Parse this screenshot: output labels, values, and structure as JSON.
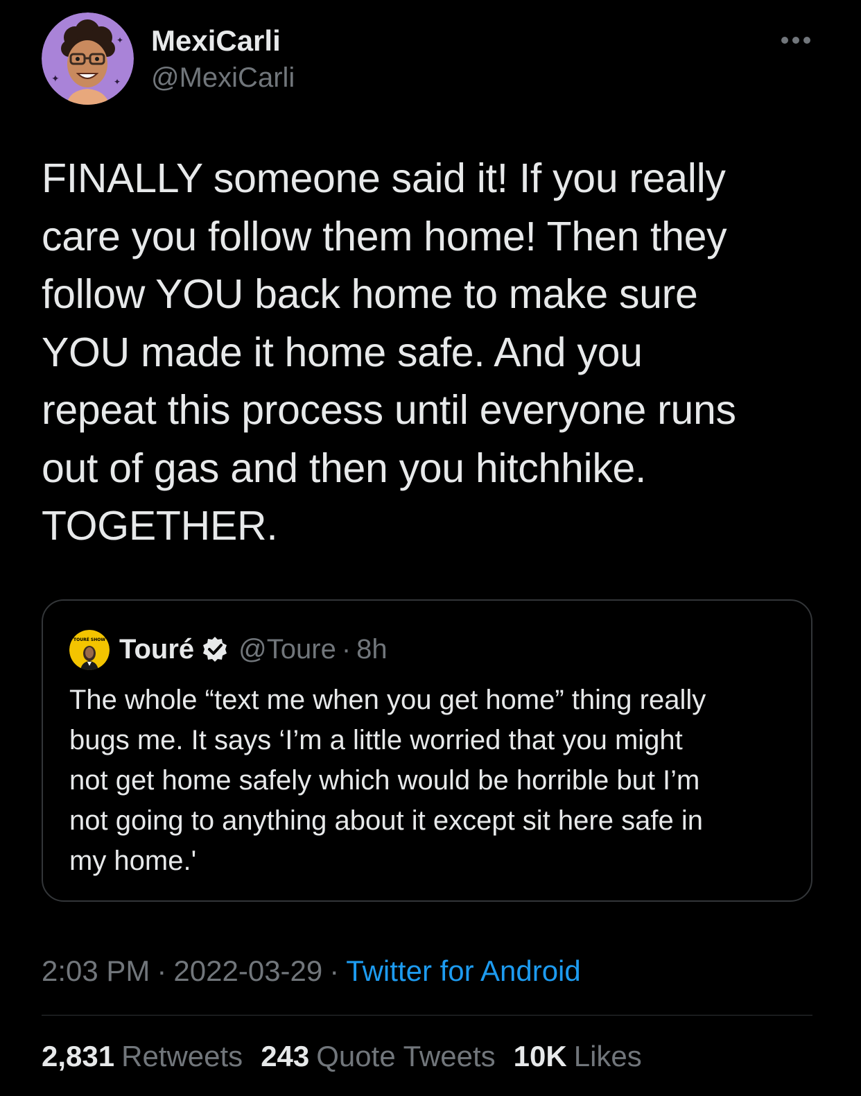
{
  "colors": {
    "background": "#000000",
    "text_primary": "#e7e9ea",
    "text_secondary": "#71767b",
    "link": "#1d9bf0",
    "border": "#333639",
    "avatar_background": "#a983d8",
    "quote_avatar_background": "#f3c400"
  },
  "author": {
    "name": "MexiCarli",
    "handle": "@MexiCarli",
    "avatar_icon": "cartoon-avatar-icon"
  },
  "menu": {
    "icon": "more-horizontal-icon"
  },
  "tweet": {
    "text": "FINALLY someone said it! If you really\ncare you follow them home! Then they\nfollow YOU back home to make sure\nYOU made it home safe. And you\nrepeat this process until everyone runs\nout of gas and then you hitchhike.\nTOGETHER."
  },
  "quote": {
    "name": "Touré",
    "verified_icon": "verified-badge-icon",
    "handle": "@Toure",
    "separator": "·",
    "time": "8h",
    "avatar_label": "TOURÉ SHOW",
    "text": "The whole “text me when you get home” thing really\nbugs me. It says ‘I’m a little worried that you might\nnot get home safely which would be horrible but I’m\nnot going to anything about it except sit here safe in\nmy home.'"
  },
  "meta": {
    "time": "2:03 PM",
    "separator": "·",
    "date": "2022-03-29",
    "source": "Twitter for Android"
  },
  "stats": {
    "retweets_count": "2,831",
    "retweets_label": "Retweets",
    "quotes_count": "243",
    "quotes_label": "Quote Tweets",
    "likes_count": "10K",
    "likes_label": "Likes"
  }
}
